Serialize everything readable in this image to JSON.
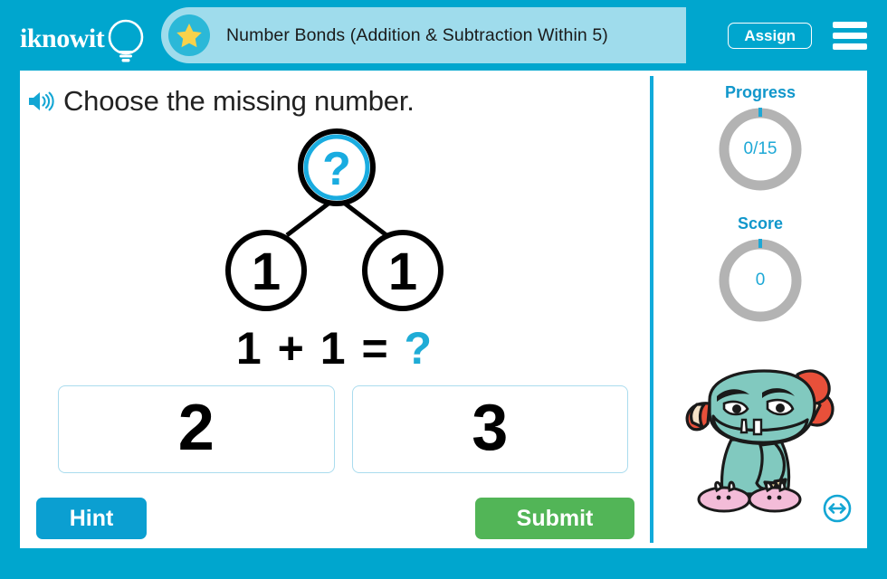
{
  "app": {
    "brand": "iknowit",
    "accent_color": "#00a6ce",
    "title_pill_color": "#9fdcec",
    "green_color": "#52b557"
  },
  "header": {
    "title": "Number Bonds (Addition & Subtraction Within 5)",
    "assign_label": "Assign",
    "star_icon": "star-icon",
    "menu_icon": "hamburger-menu-icon",
    "logo_icon": "lightbulb-icon"
  },
  "question": {
    "audio_icon": "speaker-icon",
    "prompt": "Choose the missing number.",
    "number_bond": {
      "whole": "?",
      "whole_is_unknown": true,
      "part_left": "1",
      "part_right": "1"
    },
    "equation": {
      "left": "1",
      "operator": "+",
      "right": "1",
      "equals": "=",
      "answer": "?"
    },
    "choices": [
      {
        "label": "2",
        "selected": false
      },
      {
        "label": "3",
        "selected": false
      }
    ]
  },
  "actions": {
    "hint_label": "Hint",
    "submit_label": "Submit"
  },
  "sidebar": {
    "progress": {
      "title": "Progress",
      "value": "0/15"
    },
    "score": {
      "title": "Score",
      "value": "0"
    },
    "mascot_icon": "monster-mascot",
    "resize_icon": "resize-horizontal-icon"
  }
}
